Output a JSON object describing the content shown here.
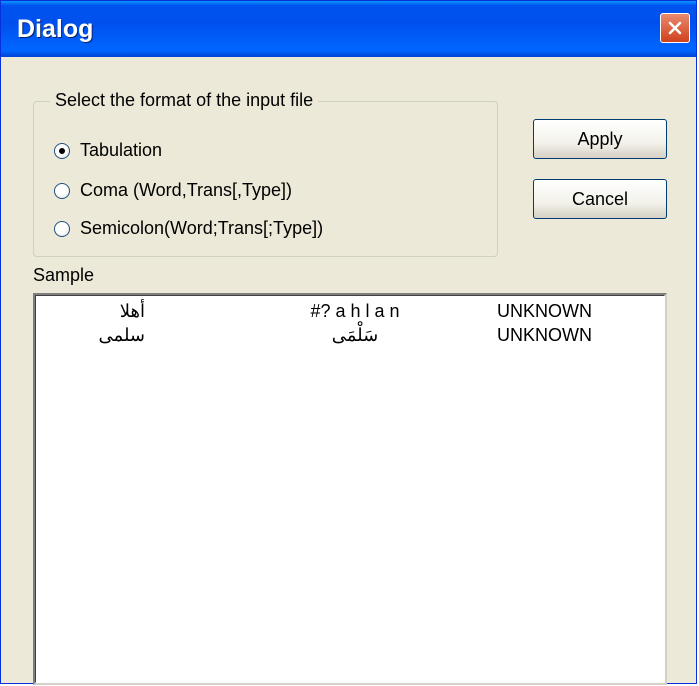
{
  "window": {
    "title": "Dialog"
  },
  "format_group": {
    "label": "Select the format of the input file",
    "options": [
      {
        "label": "Tabulation",
        "selected": true
      },
      {
        "label": "Coma (Word,Trans[,Type])",
        "selected": false
      },
      {
        "label": "Semicolon(Word;Trans[;Type])",
        "selected": false
      }
    ]
  },
  "buttons": {
    "apply": "Apply",
    "cancel": "Cancel"
  },
  "sample": {
    "label": "Sample",
    "rows": [
      {
        "word": "أهلا",
        "trans": "#? a h l a n",
        "type": "UNKNOWN"
      },
      {
        "word": "سلمى",
        "trans": "سَلْمَى",
        "type": "UNKNOWN"
      }
    ]
  },
  "colors": {
    "titlebar": "#0053ee",
    "dialog_bg": "#ece9d8",
    "close_button": "#d0401c"
  },
  "icons": {
    "close": "close-icon"
  }
}
